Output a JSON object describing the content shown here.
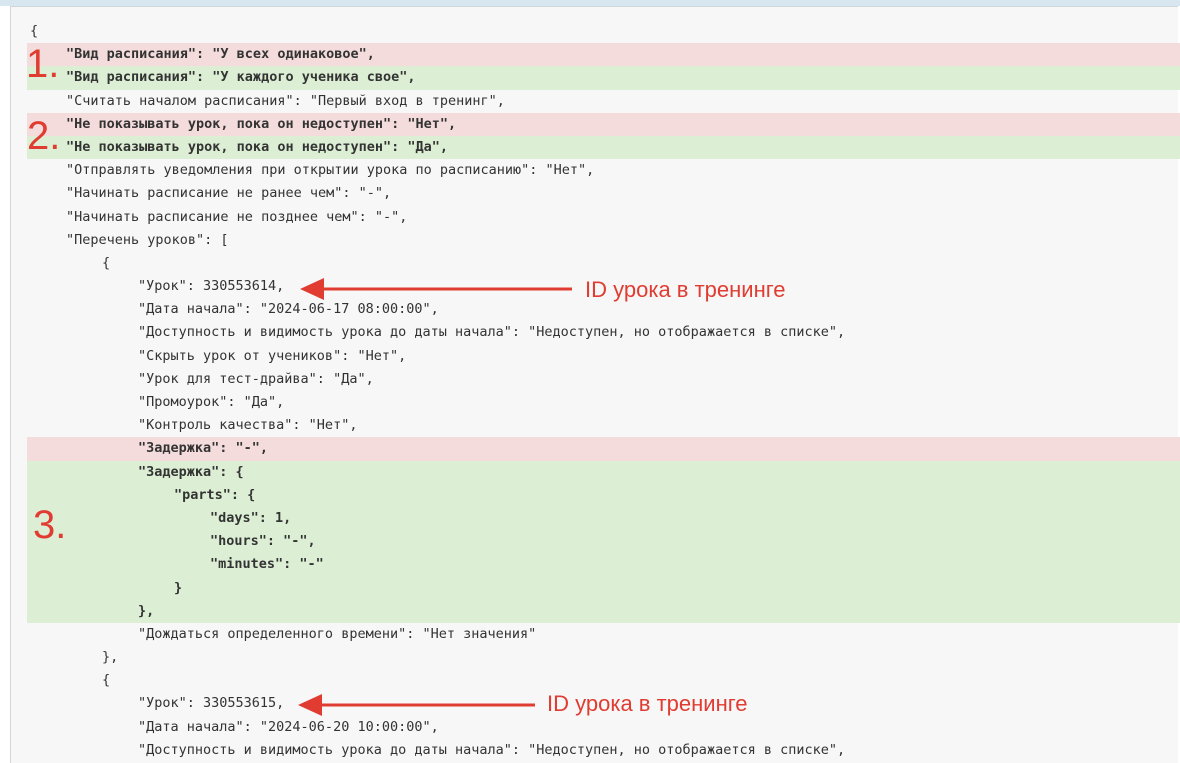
{
  "diff_lines": [
    {
      "text": "{",
      "kind": "normal",
      "indent": 0
    },
    {
      "text": "\"Вид расписания\": \"У всех одинаковое\",",
      "kind": "del",
      "indent": 1
    },
    {
      "text": "\"Вид расписания\": \"У каждого ученика свое\",",
      "kind": "add",
      "indent": 1
    },
    {
      "text": "\"Считать началом расписания\": \"Первый вход в тренинг\",",
      "kind": "normal",
      "indent": 1
    },
    {
      "text": "\"Не показывать урок, пока он недоступен\": \"Нет\",",
      "kind": "del",
      "indent": 1
    },
    {
      "text": "\"Не показывать урок, пока он недоступен\": \"Да\",",
      "kind": "add",
      "indent": 1
    },
    {
      "text": "\"Отправлять уведомления при открытии урока по расписанию\": \"Нет\",",
      "kind": "normal",
      "indent": 1
    },
    {
      "text": "\"Начинать расписание не ранее чем\": \"-\",",
      "kind": "normal",
      "indent": 1
    },
    {
      "text": "\"Начинать расписание не позднее чем\": \"-\",",
      "kind": "normal",
      "indent": 1
    },
    {
      "text": "\"Перечень уроков\": [",
      "kind": "normal",
      "indent": 1
    },
    {
      "text": "{",
      "kind": "normal",
      "indent": 2
    },
    {
      "text": "\"Урок\": 330553614,",
      "kind": "normal",
      "indent": 3
    },
    {
      "text": "\"Дата начала\": \"2024-06-17 08:00:00\",",
      "kind": "normal",
      "indent": 3
    },
    {
      "text": "\"Доступность и видимость урока до даты начала\": \"Недоступен, но отображается в списке\",",
      "kind": "normal",
      "indent": 3
    },
    {
      "text": "\"Скрыть урок от учеников\": \"Нет\",",
      "kind": "normal",
      "indent": 3
    },
    {
      "text": "\"Урок для тест-драйва\": \"Да\",",
      "kind": "normal",
      "indent": 3
    },
    {
      "text": "\"Промоурок\": \"Да\",",
      "kind": "normal",
      "indent": 3
    },
    {
      "text": "\"Контроль качества\": \"Нет\",",
      "kind": "normal",
      "indent": 3
    },
    {
      "text": "\"Задержка\": \"-\",",
      "kind": "del",
      "indent": 3
    },
    {
      "text": "\"Задержка\": {",
      "kind": "add",
      "indent": 3
    },
    {
      "text": "\"parts\": {",
      "kind": "add",
      "indent": 4
    },
    {
      "text": "\"days\": 1,",
      "kind": "add",
      "indent": 5
    },
    {
      "text": "\"hours\": \"-\",",
      "kind": "add",
      "indent": 5
    },
    {
      "text": "\"minutes\": \"-\"",
      "kind": "add",
      "indent": 5
    },
    {
      "text": "}",
      "kind": "add",
      "indent": 4
    },
    {
      "text": "},",
      "kind": "add",
      "indent": 3
    },
    {
      "text": "\"Дождаться определенного времени\": \"Нет значения\"",
      "kind": "normal",
      "indent": 3
    },
    {
      "text": "},",
      "kind": "normal",
      "indent": 2
    },
    {
      "text": "{",
      "kind": "normal",
      "indent": 2
    },
    {
      "text": "\"Урок\": 330553615,",
      "kind": "normal",
      "indent": 3
    },
    {
      "text": "\"Дата начала\": \"2024-06-20 10:00:00\",",
      "kind": "normal",
      "indent": 3
    },
    {
      "text": "\"Доступность и видимость урока до даты начала\": \"Недоступен, но отображается в списке\",",
      "kind": "normal",
      "indent": 3
    }
  ],
  "markers": {
    "m1": "1.",
    "m2": "2.",
    "m3": "3."
  },
  "notes": {
    "lesson_id_1": "ID урока в тренинге",
    "lesson_id_2": "ID урока в тренинге"
  },
  "colors": {
    "deleted_bg": "#f4dcdc",
    "added_bg": "#dcefd5",
    "annotation": "#e03c31"
  }
}
